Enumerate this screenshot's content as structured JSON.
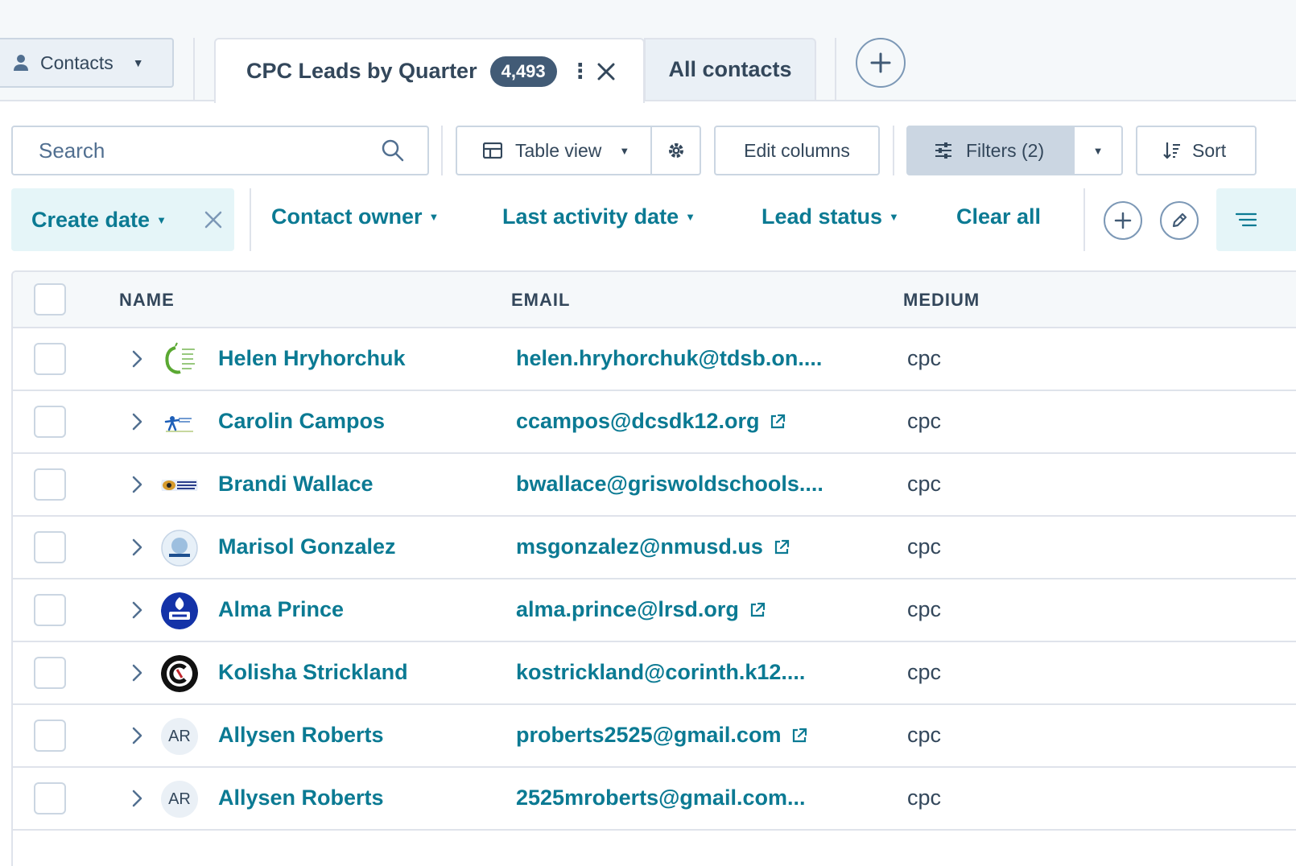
{
  "object_selector": {
    "label": "Contacts"
  },
  "tabs": {
    "active": {
      "label": "CPC Leads by Quarter",
      "count": "4,493"
    },
    "other": {
      "label": "All contacts"
    }
  },
  "toolbar": {
    "search_placeholder": "Search",
    "table_view_label": "Table view",
    "edit_columns_label": "Edit columns",
    "filters_label": "Filters (2)",
    "sort_label": "Sort"
  },
  "filterbar": {
    "chip_label": "Create date",
    "contact_owner": "Contact owner",
    "last_activity": "Last activity date",
    "lead_status": "Lead status",
    "clear_all": "Clear all"
  },
  "table": {
    "headers": {
      "name": "NAME",
      "email": "EMAIL",
      "medium": "MEDIUM"
    },
    "rows": [
      {
        "name": "Helen Hryhorchuk",
        "email": "helen.hryhorchuk@tdsb.on....",
        "medium": "cpc",
        "avatar": "logo-tdsb"
      },
      {
        "name": "Carolin Campos",
        "email": "ccampos@dcsdk12.org",
        "medium": "cpc",
        "avatar": "logo-dcsd",
        "external": true
      },
      {
        "name": "Brandi Wallace",
        "email": "bwallace@griswoldschools....",
        "medium": "cpc",
        "avatar": "logo-griswold"
      },
      {
        "name": "Marisol Gonzalez",
        "email": "msgonzalez@nmusd.us",
        "medium": "cpc",
        "avatar": "logo-nmusd",
        "external": true
      },
      {
        "name": "Alma Prince",
        "email": "alma.prince@lrsd.org",
        "medium": "cpc",
        "avatar": "logo-lrsd",
        "external": true
      },
      {
        "name": "Kolisha Strickland",
        "email": "kostrickland@corinth.k12....",
        "medium": "cpc",
        "avatar": "logo-corinth"
      },
      {
        "name": "Allysen Roberts",
        "email": "proberts2525@gmail.com",
        "medium": "cpc",
        "avatar": "AR",
        "external": true
      },
      {
        "name": "Allysen Roberts",
        "email": "2525mroberts@gmail.com...",
        "medium": "cpc",
        "avatar": "AR"
      }
    ]
  },
  "colors": {
    "accent": "#0b7a93",
    "text": "#33475b",
    "border": "#cbd6e2",
    "chip_bg": "#e5f5f8"
  }
}
